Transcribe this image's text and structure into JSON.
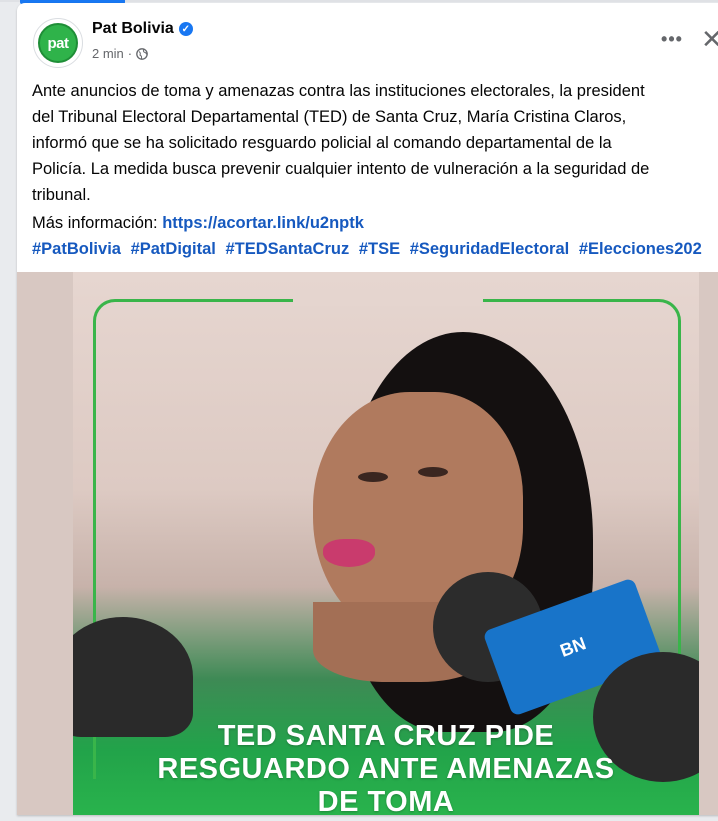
{
  "post": {
    "page_name": "Pat Bolivia",
    "avatar_text": "pat",
    "time": "2 min",
    "meta_separator": "·",
    "more_label": "•••",
    "close_label": "✕",
    "body": "Ante anuncios de toma y amenazas contra las instituciones electorales, la president\ndel Tribunal Electoral Departamental (TED) de Santa Cruz, María Cristina Claros,\ninformó que se ha solicitado resguardo policial al comando departamental de la\nPolicía. La medida busca prevenir cualquier intento de vulneración a la seguridad de\ntribunal.",
    "more_info_label": "Más información: ",
    "link": "https://acortar.link/u2nptk",
    "hashtags": [
      "#PatBolivia",
      "#PatDigital",
      "#TEDSantaCruz",
      "#TSE",
      "#SeguridadElectoral",
      "#Elecciones202"
    ]
  },
  "media": {
    "headline_lines": [
      "TED SANTA CRUZ PIDE",
      "RESGUARDO ANTE AMENAZAS",
      "DE TOMA"
    ],
    "mic_label": "BN"
  },
  "icons": {
    "verified": "verified-badge-icon",
    "privacy": "globe-icon",
    "more": "more-options-icon",
    "close": "close-icon"
  },
  "colors": {
    "link": "#1659bf",
    "brand_green": "#2fb34a",
    "verified_blue": "#1877f2"
  }
}
